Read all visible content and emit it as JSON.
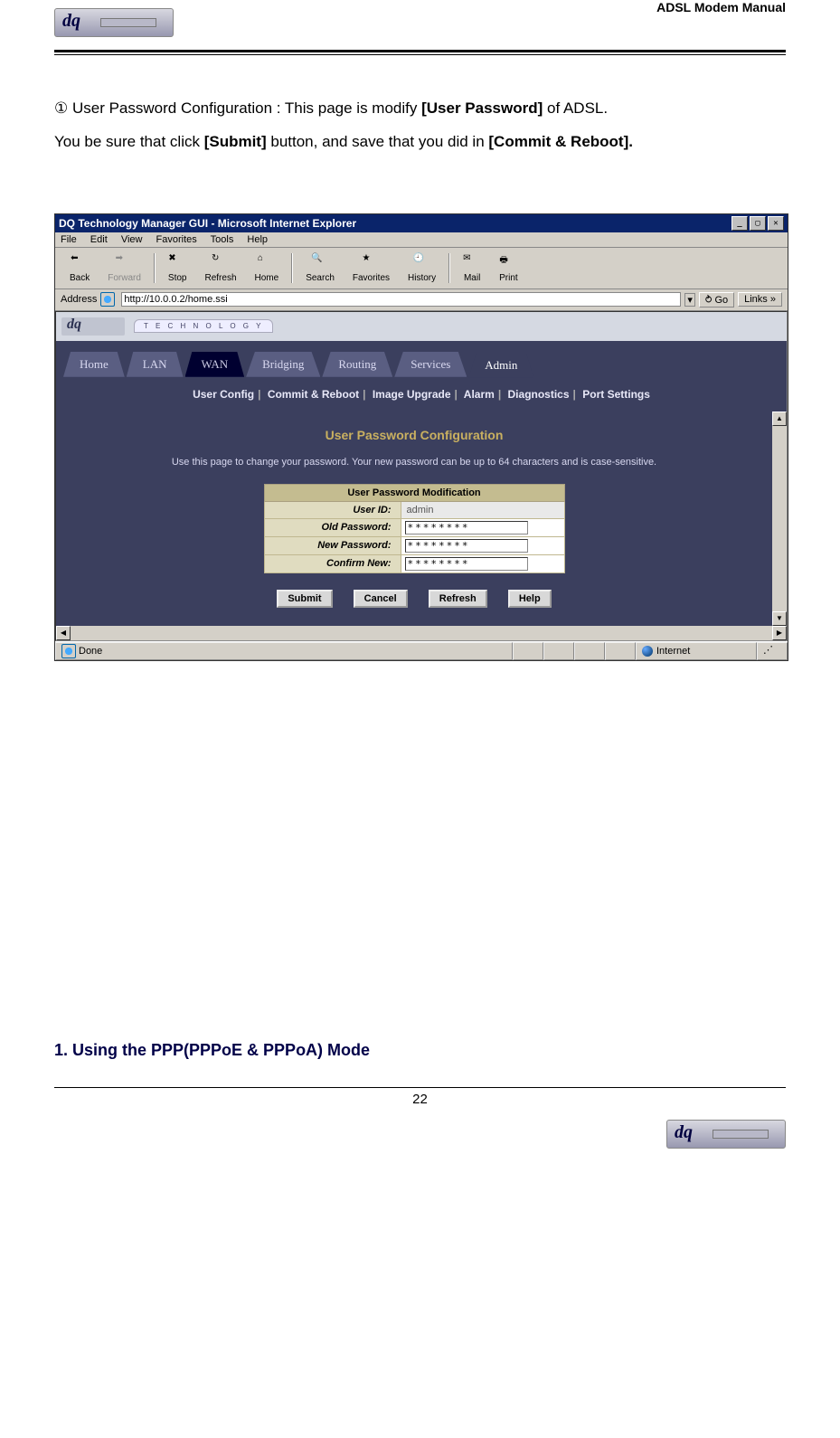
{
  "header": {
    "title": "ADSL Modem Manual"
  },
  "body": {
    "line1_prefix": "① User Password Configuration : This page is modify ",
    "line1_bold": "[User Password]",
    "line1_suffix": " of ADSL.",
    "line2_prefix": "You be sure that click ",
    "line2_bold1": "[Submit]",
    "line2_mid": " button, and save that you did in ",
    "line2_bold2": "[Commit & Reboot]."
  },
  "ie": {
    "title": "DQ Technology Manager GUI - Microsoft Internet Explorer",
    "menus": [
      "File",
      "Edit",
      "View",
      "Favorites",
      "Tools",
      "Help"
    ],
    "toolbar": {
      "back": "Back",
      "forward": "Forward",
      "stop": "Stop",
      "refresh": "Refresh",
      "home": "Home",
      "search": "Search",
      "favorites": "Favorites",
      "history": "History",
      "mail": "Mail",
      "print": "Print"
    },
    "address_label": "Address",
    "address_value": "http://10.0.0.2/home.ssi",
    "go_label": "Go",
    "links_label": "Links",
    "status_done": "Done",
    "status_zone": "Internet"
  },
  "gui": {
    "brand_tab": "T E C H N O L O G Y",
    "tabs": [
      "Home",
      "LAN",
      "WAN",
      "Bridging",
      "Routing",
      "Services",
      "Admin"
    ],
    "subnav": [
      "User Config",
      "Commit & Reboot",
      "Image Upgrade",
      "Alarm",
      "Diagnostics",
      "Port Settings"
    ],
    "panel_title": "User Password Configuration",
    "panel_desc": "Use this page to change your password. Your new password can be up to 64 characters and is case-sensitive.",
    "table_header": "User Password Modification",
    "rows": {
      "user_id_label": "User ID:",
      "user_id_value": "admin",
      "old_pw_label": "Old Password:",
      "old_pw_value": "********",
      "new_pw_label": "New Password:",
      "new_pw_value": "********",
      "confirm_label": "Confirm New:",
      "confirm_value": "********"
    },
    "buttons": {
      "submit": "Submit",
      "cancel": "Cancel",
      "refresh": "Refresh",
      "help": "Help"
    }
  },
  "section_heading": "1. Using the PPP(PPPoE & PPPoA) Mode",
  "page_number": "22"
}
